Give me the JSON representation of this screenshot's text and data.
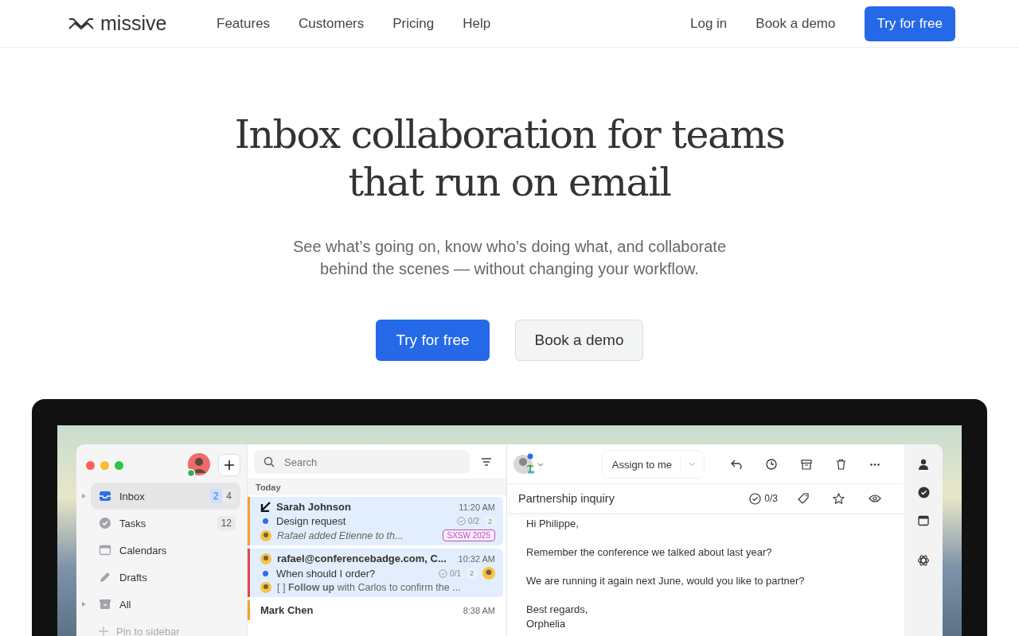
{
  "nav": {
    "logo": "missive",
    "links": [
      "Features",
      "Customers",
      "Pricing",
      "Help"
    ],
    "login": "Log in",
    "demo": "Book a demo",
    "cta": "Try for free"
  },
  "hero": {
    "title": "Inbox collaboration for teams that run on email",
    "subtitle": "See what’s going on, know who’s doing what, and collaborate behind the scenes — without changing your workflow.",
    "primary": "Try for free",
    "secondary": "Book a demo"
  },
  "app": {
    "sidebar": [
      {
        "label": "Inbox",
        "selected": true,
        "expandable": true,
        "counts": [
          "2",
          "4"
        ]
      },
      {
        "label": "Tasks",
        "selected": false,
        "expandable": false,
        "counts": [
          "12"
        ]
      },
      {
        "label": "Calendars",
        "selected": false,
        "expandable": false
      },
      {
        "label": "Drafts",
        "selected": false,
        "expandable": false
      },
      {
        "label": "All",
        "selected": false,
        "expandable": true
      }
    ],
    "pin": "Pin to sidebar",
    "search": {
      "placeholder": "Search"
    },
    "section": "Today",
    "emails": [
      {
        "sender": "Sarah Johnson",
        "time": "11:20 AM",
        "subject": "Design request",
        "tasks": "0/2",
        "replies": "2",
        "preview": "Rafael added Etienne to th...",
        "italic": true,
        "tag": {
          "label": "SXSW 2025",
          "color": "#b84fc4"
        },
        "color": "#f0a030",
        "selected": true,
        "unread": true
      },
      {
        "sender": "rafael@conferencebadge.com, C...",
        "time": "10:32 AM",
        "subject": "When should I order?",
        "tasks": "0/1",
        "replies": "2",
        "preview": "[ ] **Follow up** with Carlos to confirm the ...",
        "italic": false,
        "color": "#e04848",
        "selected": true,
        "unread": true
      },
      {
        "sender": "Mark Chen",
        "time": "8:38 AM",
        "color": "#f0a030",
        "selected": false
      }
    ],
    "assign": "Assign to me",
    "thread": {
      "subject": "Partnership inquiry",
      "tasks": "0/3",
      "body": [
        "Hi Philippe,",
        "Remember the conference we talked about last year?",
        "We are running it again next June, would you like to partner?",
        "Best regards,\nOrphelia"
      ]
    }
  }
}
